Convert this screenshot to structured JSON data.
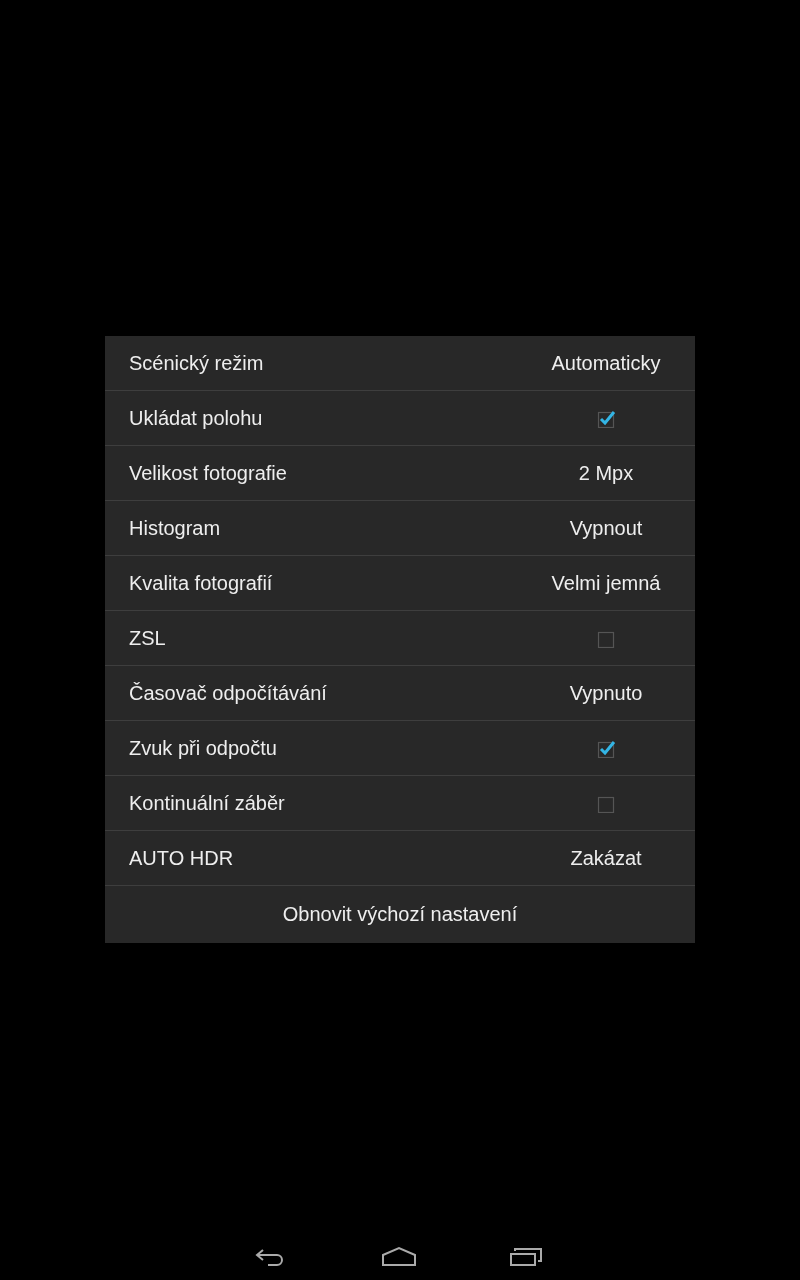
{
  "settings": [
    {
      "label": "Scénický režim",
      "kind": "value",
      "value": "Automaticky"
    },
    {
      "label": "Ukládat polohu",
      "kind": "checkbox",
      "checked": true
    },
    {
      "label": "Velikost fotografie",
      "kind": "value",
      "value": "2 Mpx"
    },
    {
      "label": "Histogram",
      "kind": "value",
      "value": "Vypnout"
    },
    {
      "label": "Kvalita fotografií",
      "kind": "value",
      "value": "Velmi jemná"
    },
    {
      "label": "ZSL",
      "kind": "checkbox",
      "checked": false
    },
    {
      "label": "Časovač odpočítávání",
      "kind": "value",
      "value": "Vypnuto"
    },
    {
      "label": "Zvuk při odpočtu",
      "kind": "checkbox",
      "checked": true
    },
    {
      "label": "Kontinuální záběr",
      "kind": "checkbox",
      "checked": false
    },
    {
      "label": "AUTO HDR",
      "kind": "value",
      "value": "Zakázat"
    }
  ],
  "reset_button": "Obnovit výchozí nastavení"
}
